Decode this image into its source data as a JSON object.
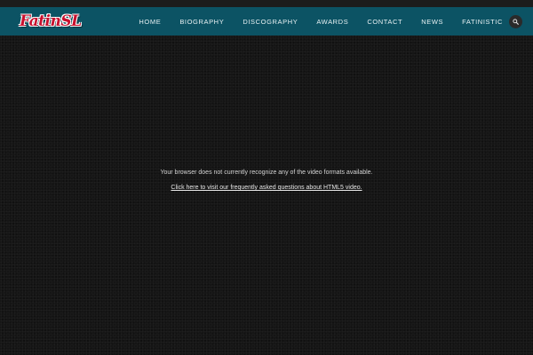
{
  "brand": {
    "logo_main": "Fatin",
    "logo_suffix": "SL"
  },
  "nav": {
    "items": [
      "HOME",
      "BIOGRAPHY",
      "DISCOGRAPHY",
      "AWARDS",
      "CONTACT",
      "NEWS",
      "FATINISTIC"
    ]
  },
  "search": {
    "icon": "search-icon"
  },
  "video": {
    "message": "Your browser does not currently recognize any of the video formats available.",
    "faq_link": "Click here to visit our frequently asked questions about HTML5 video."
  },
  "colors": {
    "navbar": "#0c5364",
    "background": "#151515",
    "logo": "#c8102e"
  }
}
